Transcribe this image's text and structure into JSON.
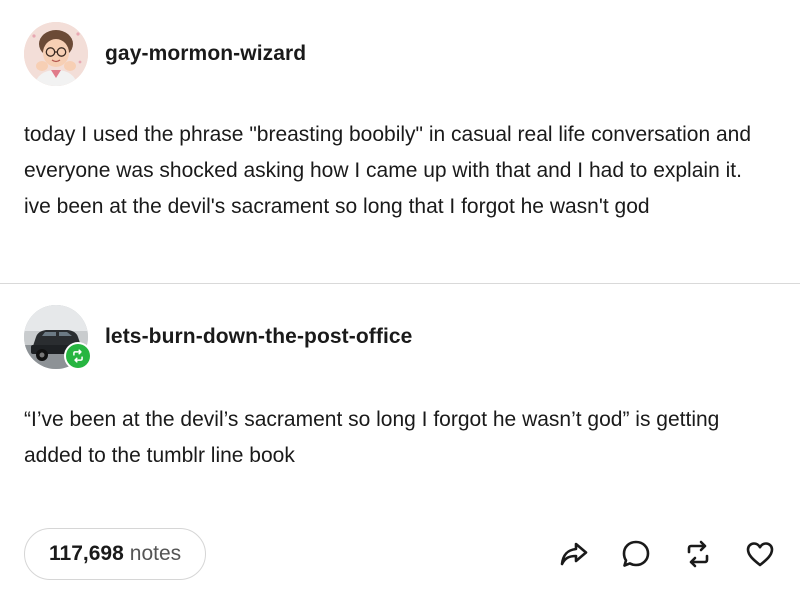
{
  "post": {
    "author": {
      "username": "gay-mormon-wizard",
      "avatar_icon": "cartoon-person-avatar-icon"
    },
    "body": "today I used the phrase \"breasting boobily\" in casual real life conversation and everyone was shocked asking how I came up with that and I had to explain it. ive been at the devil's sacrament so long that I forgot he wasn't god"
  },
  "reblog": {
    "author": {
      "username": "lets-burn-down-the-post-office",
      "avatar_icon": "car-photo-avatar-icon",
      "badge_icon": "reblog-icon",
      "badge_color": "#26b540"
    },
    "body": "“I’ve been at the devil’s sacrament so long I forgot he wasn’t god” is getting added to the tumblr line book"
  },
  "footer": {
    "notes_count": "117,698",
    "notes_label": "notes",
    "actions": [
      {
        "name": "share",
        "icon": "share-icon"
      },
      {
        "name": "reply",
        "icon": "reply-icon"
      },
      {
        "name": "reblog",
        "icon": "reblog-icon"
      },
      {
        "name": "like",
        "icon": "heart-icon"
      }
    ]
  }
}
